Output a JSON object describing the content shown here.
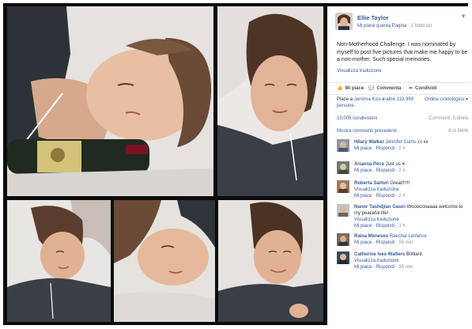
{
  "post": {
    "author": "Ellie Taylor",
    "page_like": "Mi piace questa Pagina",
    "date": "1 febbraio",
    "text": "Non-Motherhood Challenge. I was nominated by myself to post five pictures that make me happy to be a non-mother. Such special memories.",
    "see_translation": "Visualizza traduzione"
  },
  "actions": {
    "like": "Mi piace",
    "comment": "Commenta",
    "share": "Condividi"
  },
  "likes_summary": {
    "text_before": "Piace a",
    "liker": "Jemima Kiss",
    "text_and": "e",
    "others": "altre 119.999 persone."
  },
  "sort_label": "Ordine cronologico",
  "shares": "13.005 condivisioni",
  "comments_count": "Commenti: 5,8mila",
  "show_previous": "Mostra commenti precedenti",
  "pager": "6 di 5806",
  "comments": [
    {
      "author": "Hilary Walker",
      "text": "Jennifer Curtis xx",
      "like": "Mi piace",
      "reply": "Rispondi",
      "time": "2 h",
      "translate": ""
    },
    {
      "author": "Arianna Pece",
      "text": "Just us",
      "emoji": "♥",
      "like": "Mi piace",
      "reply": "Rispondi",
      "time": "2 h",
      "translate": ""
    },
    {
      "author": "Roberta Sartori",
      "text": "Great!!!!!!",
      "like": "Mi piace",
      "reply": "Rispondi",
      "time": "2 h",
      "translate": "Visualizza traduzione"
    },
    {
      "author": "Nanor Tashdjian Gauci",
      "text": "Wooooooaaaa welcome to my peaceful life!",
      "like": "Mi piace",
      "reply": "Rispondi",
      "time": "1 h",
      "translate": "Visualizza traduzione"
    },
    {
      "author": "Raisa Meneses",
      "text": "Raechal LaVance",
      "like": "Mi piace",
      "reply": "Rispondi",
      "time": "55 min",
      "translate": ""
    },
    {
      "author": "Catherine Ives Walters",
      "text": "Brilliant.",
      "like": "Mi piace",
      "reply": "Rispondi",
      "time": "35 min",
      "translate": "Visualizza traduzione"
    }
  ],
  "colors": {
    "link": "#365899",
    "muted": "#90949c",
    "text": "#1d2129",
    "heart": "#e0245e",
    "frame": "#0c0c0c"
  },
  "icons": {
    "like": "thumbs-up-icon",
    "comment": "speech-bubble-icon",
    "share": "share-arrow-icon",
    "menu": "chevron-down-icon"
  }
}
